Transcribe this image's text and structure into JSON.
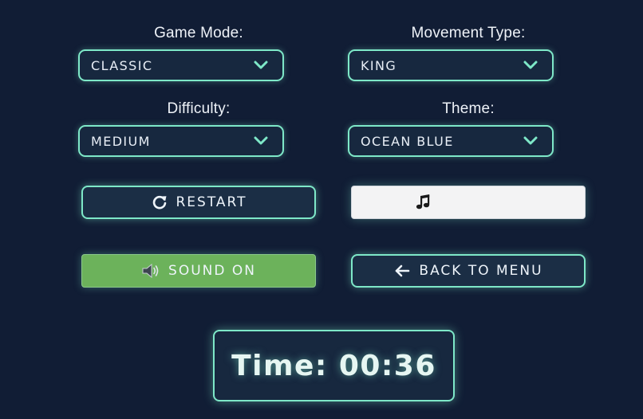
{
  "settings": {
    "game_mode": {
      "label": "Game Mode:",
      "value": "CLASSIC"
    },
    "movement_type": {
      "label": "Movement Type:",
      "value": "KING"
    },
    "difficulty": {
      "label": "Difficulty:",
      "value": "MEDIUM"
    },
    "theme": {
      "label": "Theme:",
      "value": "OCEAN BLUE"
    }
  },
  "buttons": {
    "restart": {
      "label": "RESTART",
      "icon": "restart-icon"
    },
    "music": {
      "label": "",
      "icon": "music-note-icon"
    },
    "sound": {
      "label": "SOUND ON",
      "icon": "speaker-icon"
    },
    "back": {
      "label": "BACK TO MENU",
      "icon": "arrow-left-icon"
    }
  },
  "timer": {
    "text": "Time: 00:36"
  },
  "colors": {
    "background": "#111d35",
    "accent": "#7ee8c8",
    "panel": "#17283f",
    "sound_on": "#6cb25b",
    "music_button": "#f3f3f4"
  }
}
